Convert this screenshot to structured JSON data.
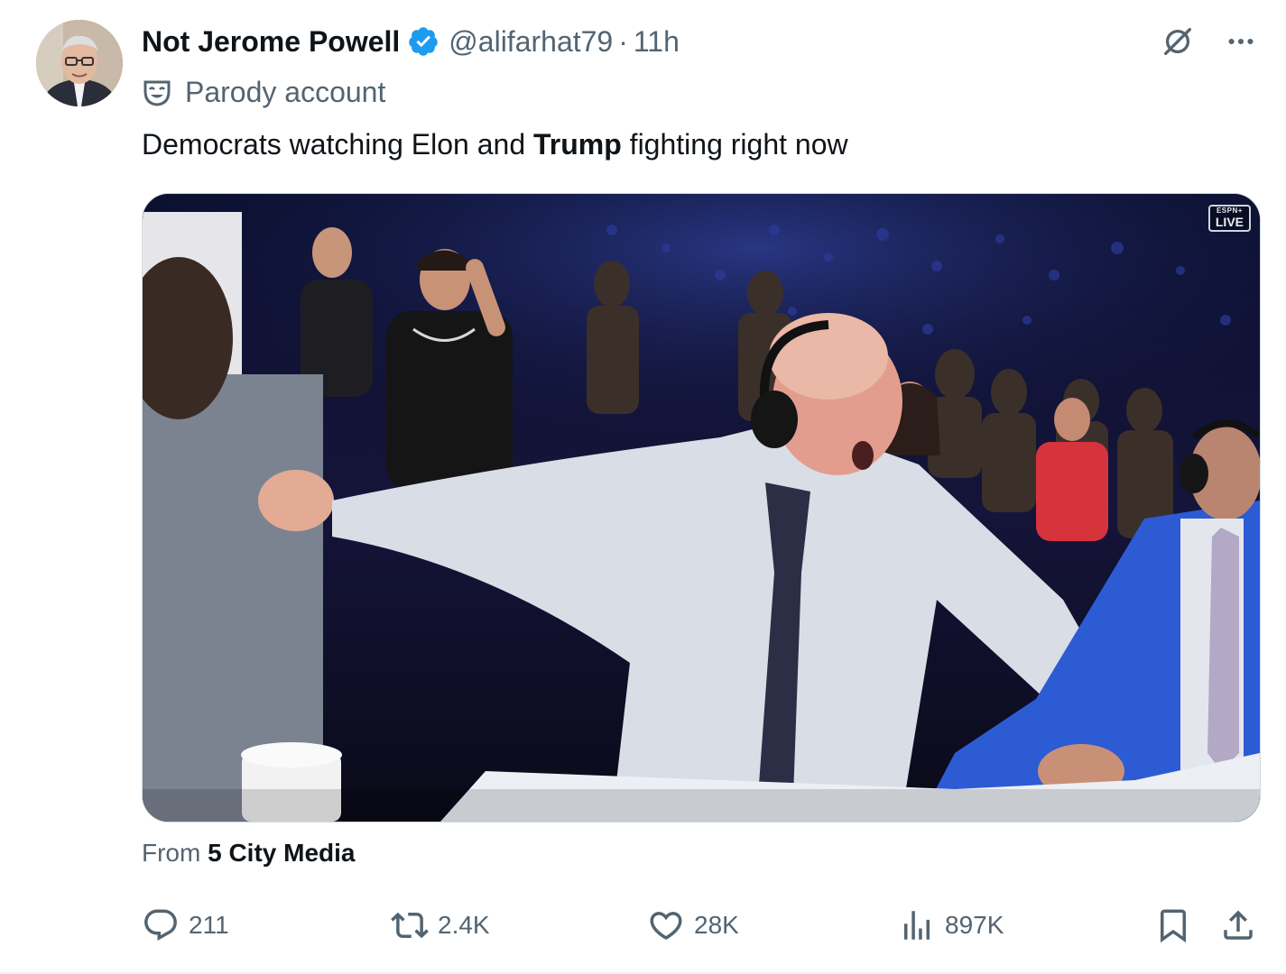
{
  "author": {
    "display_name": "Not Jerome Powell",
    "handle": "@alifarhat79",
    "separator": "·",
    "time": "11h",
    "verified": true,
    "verified_color": "#1d9bf0",
    "label": "Parody account",
    "label_icon": "theater-mask-icon"
  },
  "tweet": {
    "text_before": "Democrats watching Elon and ",
    "text_bold": "Trump",
    "text_after": " fighting right now"
  },
  "media": {
    "type": "video",
    "badge_brand": "ESPN+",
    "badge_text": "LIVE"
  },
  "source": {
    "prefix": "From",
    "name": "5 City Media"
  },
  "metrics": {
    "replies": "211",
    "reposts": "2.4K",
    "likes": "28K",
    "views": "897K"
  },
  "icons": {
    "top_right": [
      "grok-icon",
      "more-icon"
    ],
    "actions": [
      "reply-icon",
      "repost-icon",
      "like-icon",
      "views-icon",
      "bookmark-icon",
      "share-icon"
    ]
  },
  "colors": {
    "text_primary": "#0f1419",
    "text_secondary": "#536471",
    "border": "#cfd9de"
  }
}
